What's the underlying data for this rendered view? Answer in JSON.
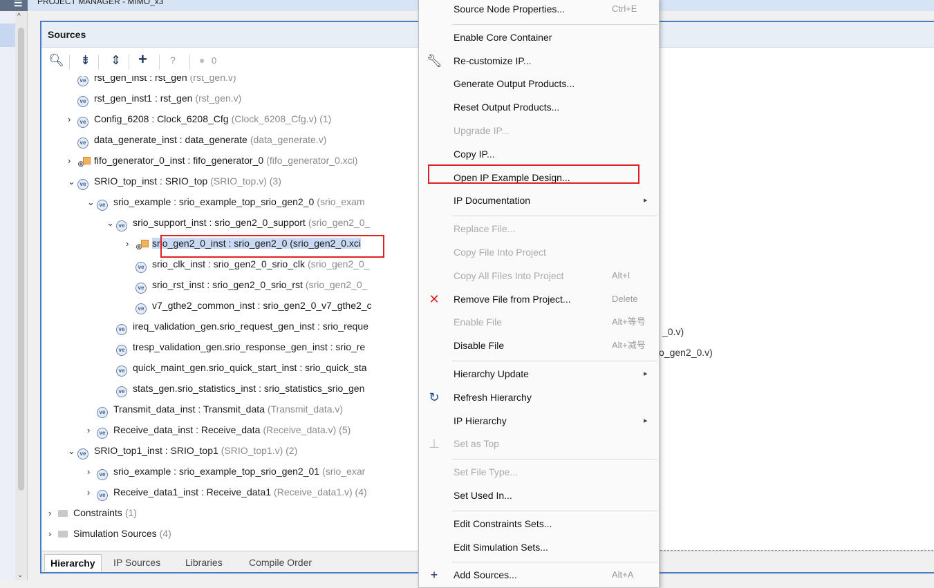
{
  "top": {
    "title": "PROJECT MANAGER - MIMO_x3"
  },
  "panel": {
    "title": "Sources",
    "toolbar": {
      "badge_count": "0"
    }
  },
  "tree": [
    {
      "indent": 1,
      "name": "rst_gen_inst : rst_gen",
      "file": "(rst_gen.v)"
    },
    {
      "indent": 1,
      "name": "rst_gen_inst1 : rst_gen",
      "file": "(rst_gen.v)"
    },
    {
      "indent": 1,
      "toggle": "›",
      "name": "Config_6208 : Clock_6208_Cfg",
      "file": "(Clock_6208_Cfg.v) (1)"
    },
    {
      "indent": 1,
      "name": "data_generate_inst : data_generate",
      "file": "(data_generate.v)"
    },
    {
      "indent": 1,
      "toggle": "›",
      "ip": true,
      "name": "fifo_generator_0_inst : fifo_generator_0",
      "file": "(fifo_generator_0.xci)"
    },
    {
      "indent": 1,
      "toggle": "⌄",
      "name": "SRIO_top_inst : SRIO_top",
      "file": "(SRIO_top.v) (3)"
    },
    {
      "indent": 2,
      "toggle": "⌄",
      "name": "srio_example : srio_example_top_srio_gen2_0",
      "file": "(srio_exam"
    },
    {
      "indent": 3,
      "toggle": "⌄",
      "name": "srio_support_inst : srio_gen2_0_support",
      "file": "(srio_gen2_0_"
    },
    {
      "indent": 4,
      "toggle": "›",
      "ip": true,
      "selected": true,
      "name": "srio_gen2_0_inst : srio_gen2_0 (srio_gen2_0.xci",
      "file": ""
    },
    {
      "indent": 4,
      "name": "srio_clk_inst : srio_gen2_0_srio_clk",
      "file": "(srio_gen2_0_"
    },
    {
      "indent": 4,
      "name": "srio_rst_inst : srio_gen2_0_srio_rst",
      "file": "(srio_gen2_0_"
    },
    {
      "indent": 4,
      "name": "v7_gthe2_common_inst : srio_gen2_0_v7_gthe2_c",
      "file": ""
    },
    {
      "indent": 3,
      "name": "ireq_validation_gen.srio_request_gen_inst : srio_reque",
      "file": ""
    },
    {
      "indent": 3,
      "name": "tresp_validation_gen.srio_response_gen_inst : srio_re",
      "file": ""
    },
    {
      "indent": 3,
      "name": "quick_maint_gen.srio_quick_start_inst : srio_quick_sta",
      "file": ""
    },
    {
      "indent": 3,
      "name": "stats_gen.srio_statistics_inst : srio_statistics_srio_gen",
      "file": ""
    },
    {
      "indent": 2,
      "name": "Transmit_data_inst : Transmit_data",
      "file": "(Transmit_data.v)"
    },
    {
      "indent": 2,
      "toggle": "›",
      "name": "Receive_data_inst : Receive_data",
      "file": "(Receive_data.v) (5)"
    },
    {
      "indent": 1,
      "toggle": "⌄",
      "name": "SRIO_top1_inst : SRIO_top1",
      "file": "(SRIO_top1.v) (2)"
    },
    {
      "indent": 2,
      "toggle": "›",
      "name": "srio_example : srio_example_top_srio_gen2_01",
      "file": "(srio_exar"
    },
    {
      "indent": 2,
      "toggle": "›",
      "name": "Receive_data1_inst : Receive_data1",
      "file": "(Receive_data1.v) (4)"
    },
    {
      "indent": 0,
      "toggle": "›",
      "folder": true,
      "name": "Constraints",
      "file": "(1)"
    },
    {
      "indent": 0,
      "toggle": "›",
      "folder": true,
      "name": "Simulation Sources",
      "file": "(4)"
    }
  ],
  "tabs": [
    "Hierarchy",
    "IP Sources",
    "Libraries",
    "Compile Order"
  ],
  "background_fragments": [
    "_0.v)",
    "o_gen2_0.v)"
  ],
  "menu": [
    {
      "label": "Source Node Properties...",
      "shortcut": "Ctrl+E"
    },
    {
      "sep": true
    },
    {
      "label": "Enable Core Container"
    },
    {
      "label": "Re-customize IP...",
      "icon": "wrench"
    },
    {
      "label": "Generate Output Products..."
    },
    {
      "label": "Reset Output Products..."
    },
    {
      "label": "Upgrade IP...",
      "disabled": true
    },
    {
      "label": "Copy IP..."
    },
    {
      "label": "Open IP Example Design...",
      "highlight": true
    },
    {
      "label": "IP Documentation",
      "submenu": true
    },
    {
      "sep": true
    },
    {
      "label": "Replace File...",
      "disabled": true
    },
    {
      "label": "Copy File Into Project",
      "disabled": true
    },
    {
      "label": "Copy All Files Into Project",
      "shortcut": "Alt+I",
      "disabled": true
    },
    {
      "label": "Remove File from Project...",
      "shortcut": "Delete",
      "icon": "remove"
    },
    {
      "label": "Enable File",
      "shortcut": "Alt+等号",
      "disabled": true
    },
    {
      "label": "Disable File",
      "shortcut": "Alt+减号"
    },
    {
      "sep": true
    },
    {
      "label": "Hierarchy Update",
      "submenu": true
    },
    {
      "label": "Refresh Hierarchy",
      "icon": "refresh"
    },
    {
      "label": "IP Hierarchy",
      "submenu": true
    },
    {
      "label": "Set as Top",
      "disabled": true,
      "icon": "settop"
    },
    {
      "sep": true
    },
    {
      "label": "Set File Type...",
      "disabled": true
    },
    {
      "label": "Set Used In..."
    },
    {
      "sep": true
    },
    {
      "label": "Edit Constraints Sets..."
    },
    {
      "label": "Edit Simulation Sets..."
    },
    {
      "sep": true
    },
    {
      "label": "Add Sources...",
      "shortcut": "Alt+A",
      "icon": "plus"
    }
  ]
}
